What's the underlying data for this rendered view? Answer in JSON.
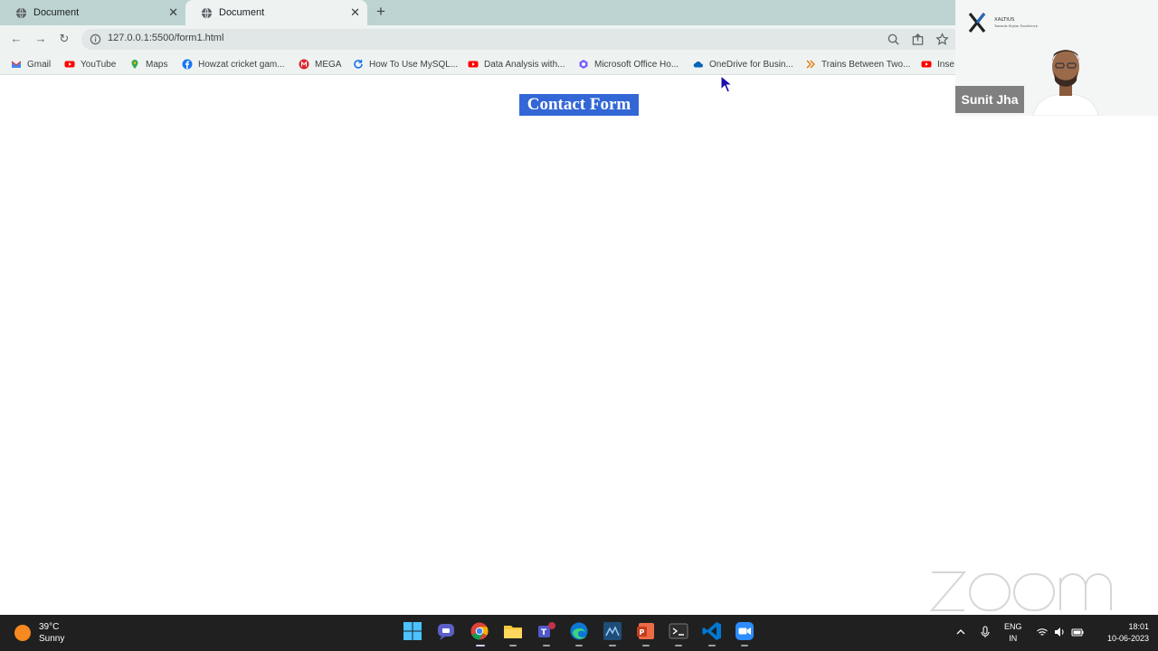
{
  "browser": {
    "tabs": [
      {
        "title": "Document"
      },
      {
        "title": "Document"
      }
    ],
    "new_tab": "+",
    "url": "127.0.0.1:5500/form1.html",
    "bookmarks": [
      {
        "label": "Gmail",
        "icon": "gmail-icon"
      },
      {
        "label": "YouTube",
        "icon": "youtube-icon"
      },
      {
        "label": "Maps",
        "icon": "maps-icon"
      },
      {
        "label": "Howzat cricket gam...",
        "icon": "facebook-icon"
      },
      {
        "label": "MEGA",
        "icon": "mega-icon"
      },
      {
        "label": "How To Use MySQL...",
        "icon": "refresh-blue-icon"
      },
      {
        "label": "Data Analysis with...",
        "icon": "youtube-icon"
      },
      {
        "label": "Microsoft Office Ho...",
        "icon": "office-icon"
      },
      {
        "label": "OneDrive for Busin...",
        "icon": "onedrive-icon"
      },
      {
        "label": "Trains Between Two...",
        "icon": "trains-icon"
      },
      {
        "label": "Inse",
        "icon": "youtube-icon"
      }
    ]
  },
  "page": {
    "heading": "Contact Form"
  },
  "zoom": {
    "speaker_name": "Sunit Jha",
    "watermark": "zoom",
    "logo_text": "XALTIUS",
    "logo_tagline": "Towards Higher Excellence"
  },
  "taskbar": {
    "weather_temp": "39°C",
    "weather_desc": "Sunny",
    "lang_line1": "ENG",
    "lang_line2": "IN",
    "time": "18:01",
    "date": "10-06-2023"
  },
  "colors": {
    "heading_highlight": "#3367d6",
    "tabstrip": "#bcd3d1",
    "taskbar": "#202020"
  }
}
